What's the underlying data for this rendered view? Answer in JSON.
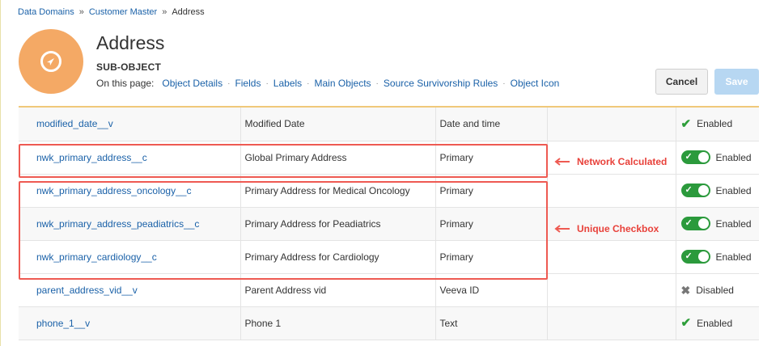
{
  "breadcrumb": {
    "items": [
      "Data Domains",
      "Customer Master",
      "Address"
    ],
    "separator": "»"
  },
  "header": {
    "icon": "compass-icon",
    "icon_color": "#f4a965",
    "title": "Address",
    "subtitle": "SUB-OBJECT",
    "on_page_label": "On this page:",
    "links": [
      "Object Details",
      "Fields",
      "Labels",
      "Main Objects",
      "Source Survivorship Rules",
      "Object Icon"
    ]
  },
  "buttons": {
    "cancel": "Cancel",
    "save": "Save"
  },
  "rows": [
    {
      "name": "modified_date__v",
      "label": "Modified Date",
      "type": "Date and time",
      "status": "Enabled",
      "status_kind": "check"
    },
    {
      "name": "nwk_primary_address__c",
      "label": "Global Primary Address",
      "type": "Primary",
      "status": "Enabled",
      "status_kind": "toggle"
    },
    {
      "name": "nwk_primary_address_oncology__c",
      "label": "Primary Address for Medical Oncology",
      "type": "Primary",
      "status": "Enabled",
      "status_kind": "toggle"
    },
    {
      "name": "nwk_primary_address_peadiatrics__c",
      "label": "Primary Address for Peadiatrics",
      "type": "Primary",
      "status": "Enabled",
      "status_kind": "toggle"
    },
    {
      "name": "nwk_primary_cardiology__c",
      "label": "Primary Address for Cardiology",
      "type": "Primary",
      "status": "Enabled",
      "status_kind": "toggle"
    },
    {
      "name": "parent_address_vid__v",
      "label": "Parent Address vid",
      "type": "Veeva ID",
      "status": "Disabled",
      "status_kind": "x"
    },
    {
      "name": "phone_1__v",
      "label": "Phone 1",
      "type": "Text",
      "status": "Enabled",
      "status_kind": "check"
    }
  ],
  "annotations": {
    "network_calculated": "Network Calculated",
    "unique_checkbox": "Unique Checkbox",
    "color": "#ee5a52"
  },
  "colors": {
    "link": "#1a61a8",
    "toggle_on": "#2b9a3c",
    "save_disabled": "#b7d7f2"
  }
}
